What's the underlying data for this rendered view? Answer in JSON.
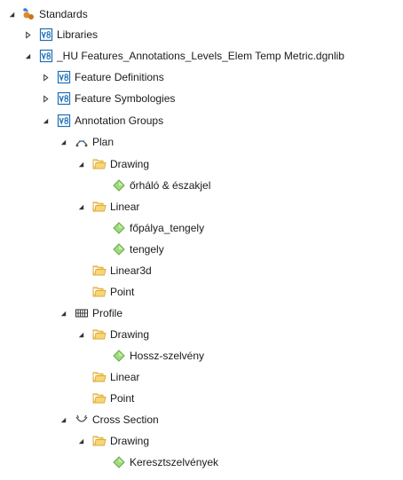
{
  "tree": {
    "standards": {
      "label": "Standards",
      "icon": "standards-icon"
    },
    "libraries": {
      "label": "Libraries",
      "icon": "v8-library-icon"
    },
    "dgnlib": {
      "label": "_HU Features_Annotations_Levels_Elem Temp Metric.dgnlib",
      "icon": "v8-library-icon"
    },
    "feature_definitions": {
      "label": "Feature Definitions",
      "icon": "v8-library-icon"
    },
    "feature_symbologies": {
      "label": "Feature Symbologies",
      "icon": "v8-library-icon"
    },
    "annotation_groups": {
      "label": "Annotation Groups",
      "icon": "v8-library-icon"
    },
    "plan": {
      "label": "Plan",
      "icon": "plan-icon",
      "drawing": {
        "label": "Drawing",
        "items": [
          "őrháló & északjel"
        ]
      },
      "linear": {
        "label": "Linear",
        "items": [
          "főpálya_tengely",
          "tengely"
        ]
      },
      "linear3d": {
        "label": "Linear3d"
      },
      "point": {
        "label": "Point"
      }
    },
    "profile": {
      "label": "Profile",
      "icon": "profile-icon",
      "drawing": {
        "label": "Drawing",
        "items": [
          "Hossz-szelvény"
        ]
      },
      "linear": {
        "label": "Linear"
      },
      "point": {
        "label": "Point"
      }
    },
    "cross_section": {
      "label": "Cross Section",
      "icon": "cross-section-icon",
      "drawing": {
        "label": "Drawing",
        "items": [
          "Keresztszelvények"
        ]
      }
    }
  },
  "colors": {
    "folder": "#f2c74e",
    "v8_blue": "#1f6fb5",
    "diamond_green": "#8fd16a",
    "expander": "#333333"
  }
}
